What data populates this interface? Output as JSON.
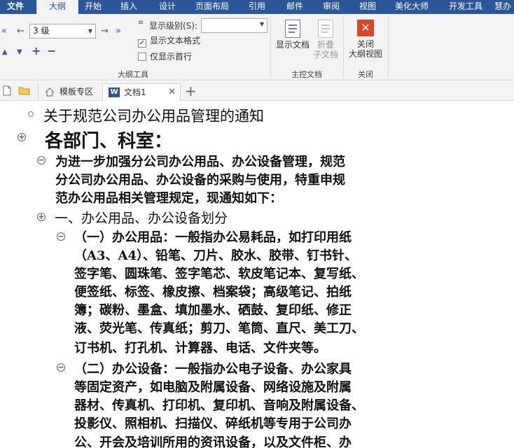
{
  "tabs": [
    "文件",
    "大纲",
    "开始",
    "插入",
    "设计",
    "页面布局",
    "引用",
    "邮件",
    "审阅",
    "视图",
    "美化大师",
    "开发工具",
    "慧办"
  ],
  "ribbon": {
    "level_value": "3 级",
    "show_level_label": "显示级别(S):",
    "show_text_format": "显示文本格式",
    "show_first_line": "仅显示首行",
    "outline_tools_label": "大纲工具",
    "show_document": "显示文档",
    "collapse_subdoc_1": "折叠",
    "collapse_subdoc_2": "子文档",
    "master_doc_label": "主控文档",
    "close_outline_1": "关闭",
    "close_outline_2": "大纲视图",
    "close_group_label": "关闭"
  },
  "doc_tabs": {
    "template_zone": "模板专区",
    "document": "文档1"
  },
  "document": {
    "lines": [
      "关于规范公司办公用品管理的通知",
      "各部门、科室：",
      "为进一步加强分公司办公用品、办公设备管理，规范",
      "分公司办公用品、办公设备的采购与使用，特重申规",
      "范办公用品相关管理规定，现通知如下：",
      "一、办公用品、办公设备划分",
      "（一）办公用品：一般指办公易耗品，如打印用纸",
      "（A3、A4）、铅笔、刀片、胶水、胶带、钉书针、",
      "签字笔、圆珠笔、签字笔芯、软皮笔记本、复写纸、",
      "便签纸、标签、橡皮擦、档案袋；高级笔记、拍纸",
      "簿；碳粉、墨盒、填加墨水、硒鼓、复印纸、修正",
      "液、荧光笔、传真纸；剪刀、笔筒、直尺、美工刀、",
      "订书机、打孔机、计算器、电话、文件夹等。",
      "（二）办公设备：一般指办公电子设备、办公家具",
      "等固定资产，如电脑及附属设备、网络设施及附属",
      "器材、传真机、打印机、复印机、音响及附属设备、",
      "投影仪、照相机、扫描仪、碎纸机等专用于公司办",
      "公、开会及培训所用的资讯设备，以及文件柜、办"
    ]
  }
}
